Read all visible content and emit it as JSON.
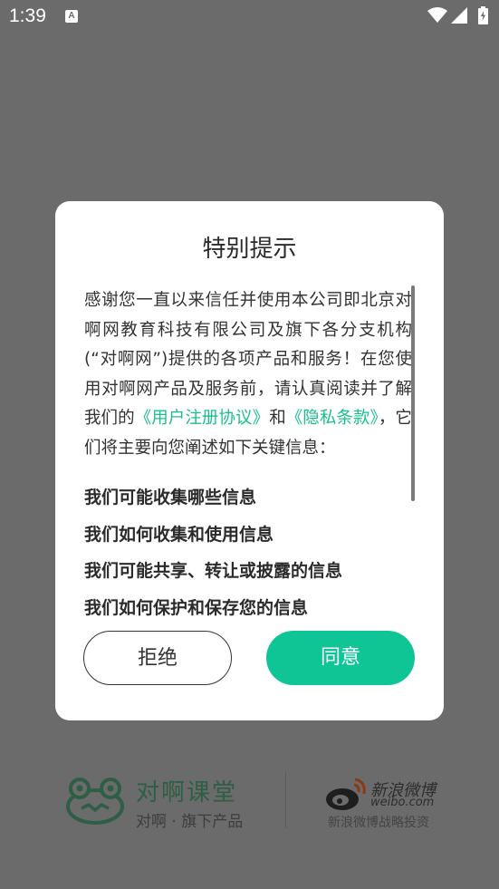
{
  "status_bar": {
    "time": "1:39",
    "notification_icon": "A"
  },
  "dialog": {
    "title": "特别提示",
    "intro_part1": "感谢您一直以来信任并使用本公司即北京对啊网教育科技有限公司及旗下各分支机构(“对啊网”)提供的各项产品和服务！在您使用对啊网产品及服务前，请认真阅读并了解我们的",
    "link_user_agreement": "《用户注册协议》",
    "intro_and": "和",
    "link_privacy": "《隐私条款》",
    "intro_part2": "，它们将主要向您阐述如下关键信息：",
    "headings": [
      "我们可能收集哪些信息",
      "我们如何收集和使用信息",
      "我们可能共享、转让或披露的信息",
      "我们如何保护和保存您的信息"
    ],
    "reject_label": "拒绝",
    "agree_label": "同意"
  },
  "brand": {
    "name": "对啊课堂",
    "sub": "对啊 · 旗下产品",
    "partner_name": "新浪微博",
    "partner_url": "weibo.com",
    "partner_sub": "新浪微博战略投资"
  },
  "colors": {
    "accent": "#0fc595",
    "link": "#1bbf8f",
    "overlay": "#6b6b6b"
  }
}
